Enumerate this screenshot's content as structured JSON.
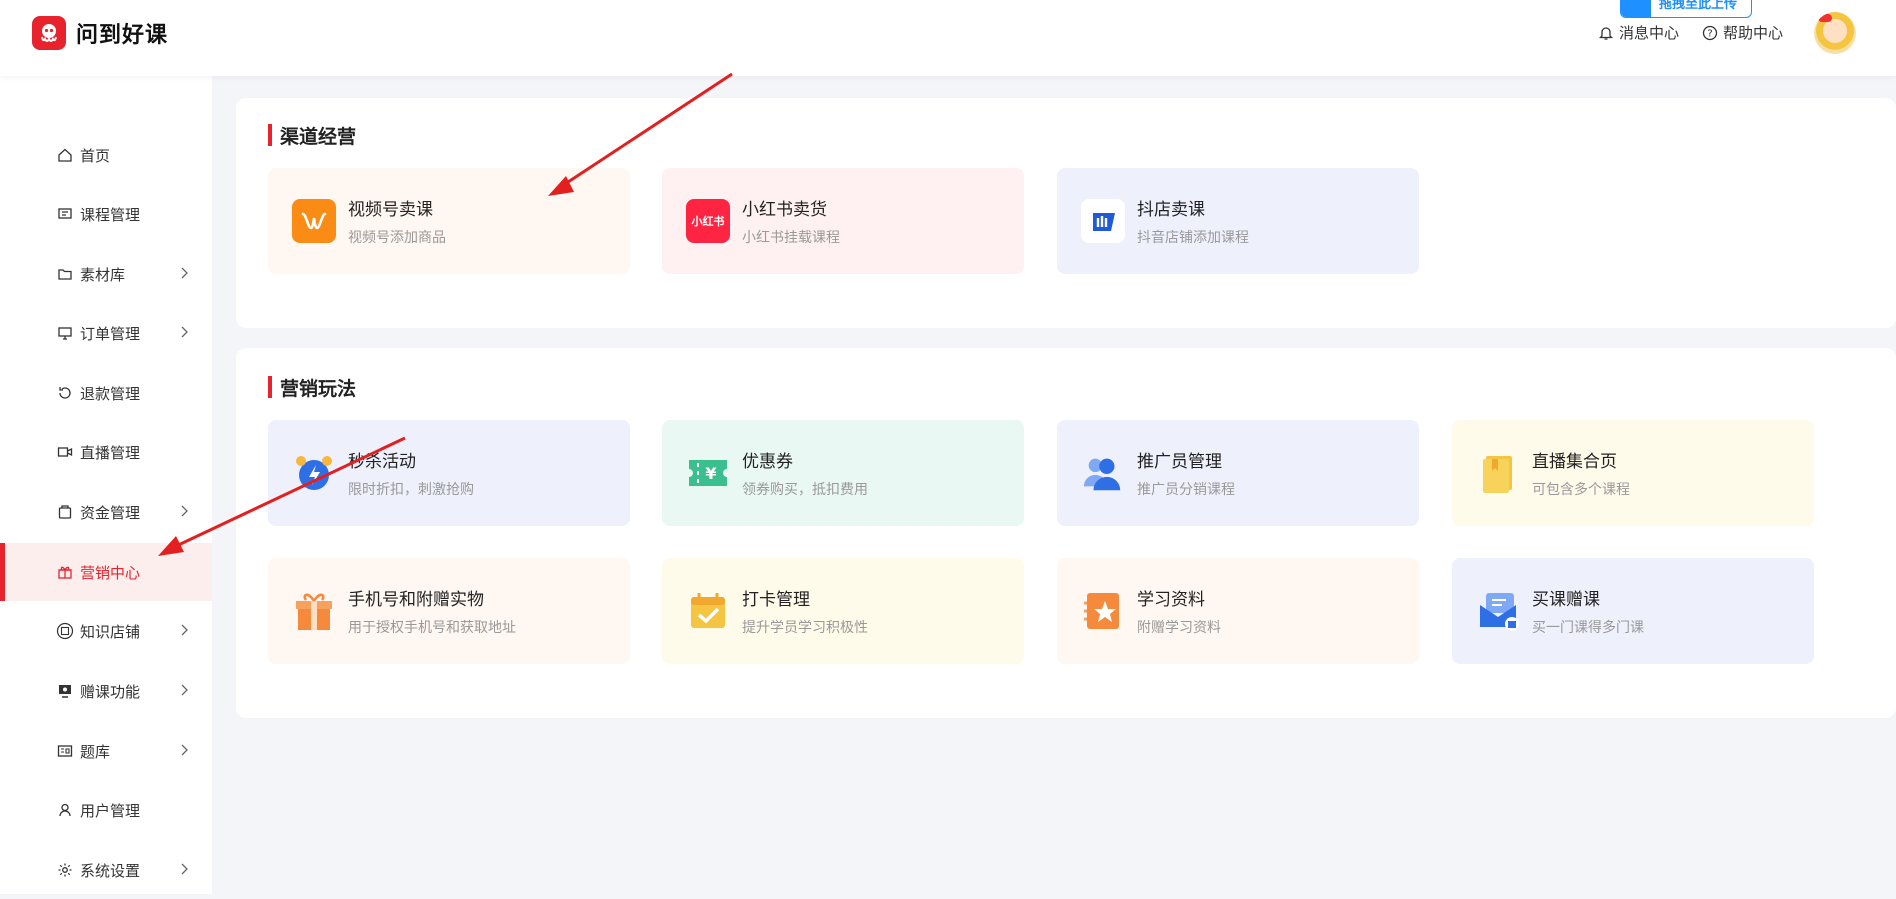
{
  "app": {
    "brand": "问到好课"
  },
  "header": {
    "upload_label": "拖拽至此上传",
    "message_center": "消息中心",
    "help_center": "帮助中心"
  },
  "sidebar": {
    "items": [
      {
        "label": "首页",
        "icon": "home-icon",
        "has_children": false
      },
      {
        "label": "课程管理",
        "icon": "course-icon",
        "has_children": false
      },
      {
        "label": "素材库",
        "icon": "folder-icon",
        "has_children": true
      },
      {
        "label": "订单管理",
        "icon": "order-icon",
        "has_children": true
      },
      {
        "label": "退款管理",
        "icon": "refund-icon",
        "has_children": false
      },
      {
        "label": "直播管理",
        "icon": "live-camera-icon",
        "has_children": false
      },
      {
        "label": "资金管理",
        "icon": "wallet-icon",
        "has_children": true
      },
      {
        "label": "营销中心",
        "icon": "gift-icon",
        "has_children": false,
        "active": true
      },
      {
        "label": "知识店铺",
        "icon": "store-icon",
        "has_children": true
      },
      {
        "label": "赠课功能",
        "icon": "gift-course-icon",
        "has_children": true
      },
      {
        "label": "题库",
        "icon": "question-bank-icon",
        "has_children": true
      },
      {
        "label": "用户管理",
        "icon": "user-icon",
        "has_children": false
      },
      {
        "label": "系统设置",
        "icon": "settings-icon",
        "has_children": true
      }
    ]
  },
  "channel": {
    "title": "渠道经营",
    "cards": [
      {
        "title": "视频号卖课",
        "subtitle": "视频号添加商品",
        "icon": "wechat-channels-icon"
      },
      {
        "title": "小红书卖货",
        "subtitle": "小红书挂载课程",
        "icon": "xiaohongshu-icon",
        "icon_text": "小红书"
      },
      {
        "title": "抖店卖课",
        "subtitle": "抖音店铺添加课程",
        "icon": "douyin-store-icon"
      }
    ]
  },
  "marketing": {
    "title": "营销玩法",
    "cards": [
      {
        "title": "秒杀活动",
        "subtitle": "限时折扣，刺激抢购",
        "icon": "alarm-clock-icon"
      },
      {
        "title": "优惠券",
        "subtitle": "领券购买，抵扣费用",
        "icon": "coupon-icon"
      },
      {
        "title": "推广员管理",
        "subtitle": "推广员分销课程",
        "icon": "promoters-icon"
      },
      {
        "title": "直播集合页",
        "subtitle": "可包含多个课程",
        "icon": "live-collection-icon"
      },
      {
        "title": "手机号和附赠实物",
        "subtitle": "用于授权手机号和获取地址",
        "icon": "gift-box-icon"
      },
      {
        "title": "打卡管理",
        "subtitle": "提升学员学习积极性",
        "icon": "checkin-calendar-icon"
      },
      {
        "title": "学习资料",
        "subtitle": "附赠学习资料",
        "icon": "study-material-icon"
      },
      {
        "title": "买课赠课",
        "subtitle": "买一门课得多门课",
        "icon": "buy-gift-course-icon"
      }
    ]
  },
  "colors": {
    "accent": "#e7232d",
    "link_blue": "#1e90ff",
    "card_bg_orange": "#fff7f1",
    "card_bg_pink": "#fff1f2",
    "card_bg_blue": "#eef0fc",
    "card_bg_green": "#eaf8f3",
    "card_bg_yellow": "#fffbea"
  }
}
